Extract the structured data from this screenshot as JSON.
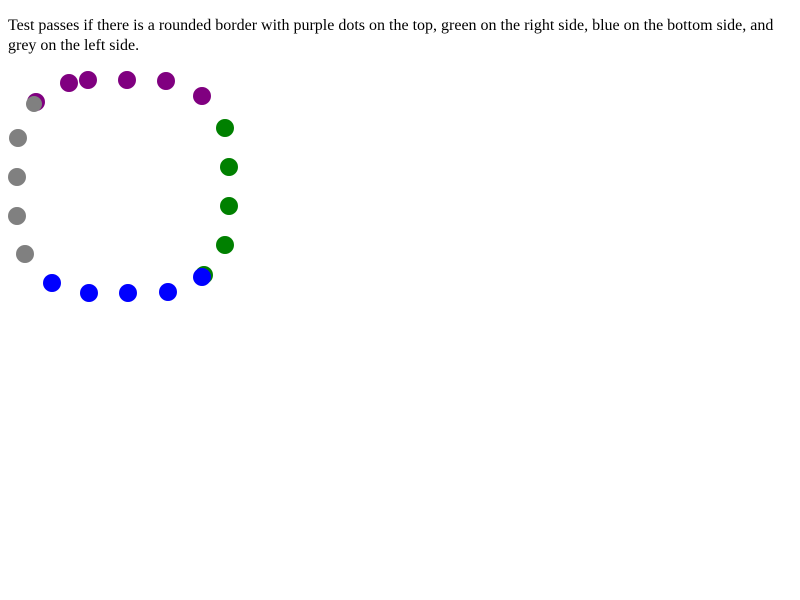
{
  "instruction": "Test passes if there is a rounded border with purple dots on the top, green on the right side, blue on the bottom side, and grey on the left side.",
  "border": {
    "style": "dotted",
    "rounded": true,
    "colors": {
      "top": "#800080",
      "right": "#008000",
      "bottom": "#0000ff",
      "left": "#808080"
    }
  }
}
